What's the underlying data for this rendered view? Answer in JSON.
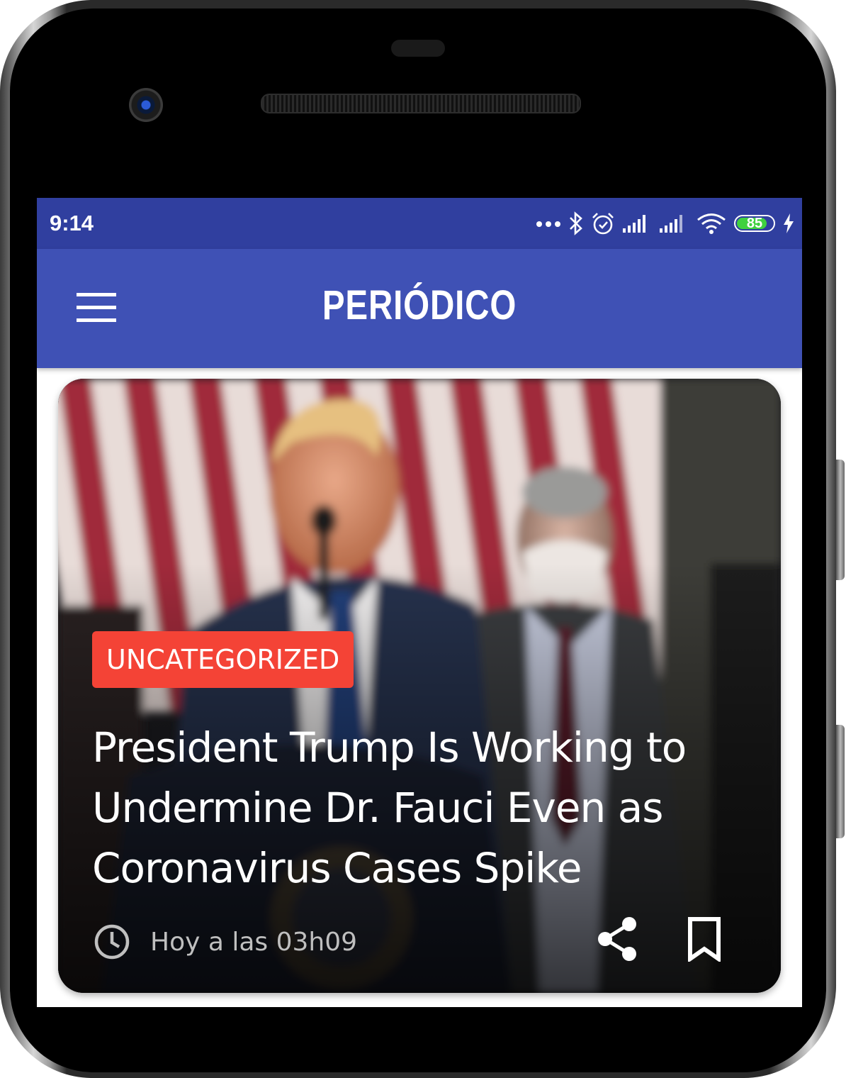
{
  "status_bar": {
    "time": "9:14",
    "battery_level": "85",
    "icons": [
      "more-dots-icon",
      "bluetooth-icon",
      "alarm-icon",
      "signal-icon",
      "signal-icon",
      "wifi-icon",
      "battery-icon",
      "charging-icon"
    ]
  },
  "app_bar": {
    "title": "PERIÓDICO",
    "menu_icon": "hamburger-menu-icon"
  },
  "article": {
    "category": "UNCATEGORIZED",
    "headline": "President Trump Is Working to Undermine Dr. Fauci Even as Coronavirus Cases Spike",
    "time": "Hoy a las 03h09",
    "time_icon": "clock-icon",
    "share_icon": "share-icon",
    "bookmark_icon": "bookmark-icon"
  },
  "colors": {
    "status_bar": "#303f9f",
    "app_bar": "#3f51b5",
    "category_badge": "#f44336",
    "battery": "#3fd13f"
  }
}
